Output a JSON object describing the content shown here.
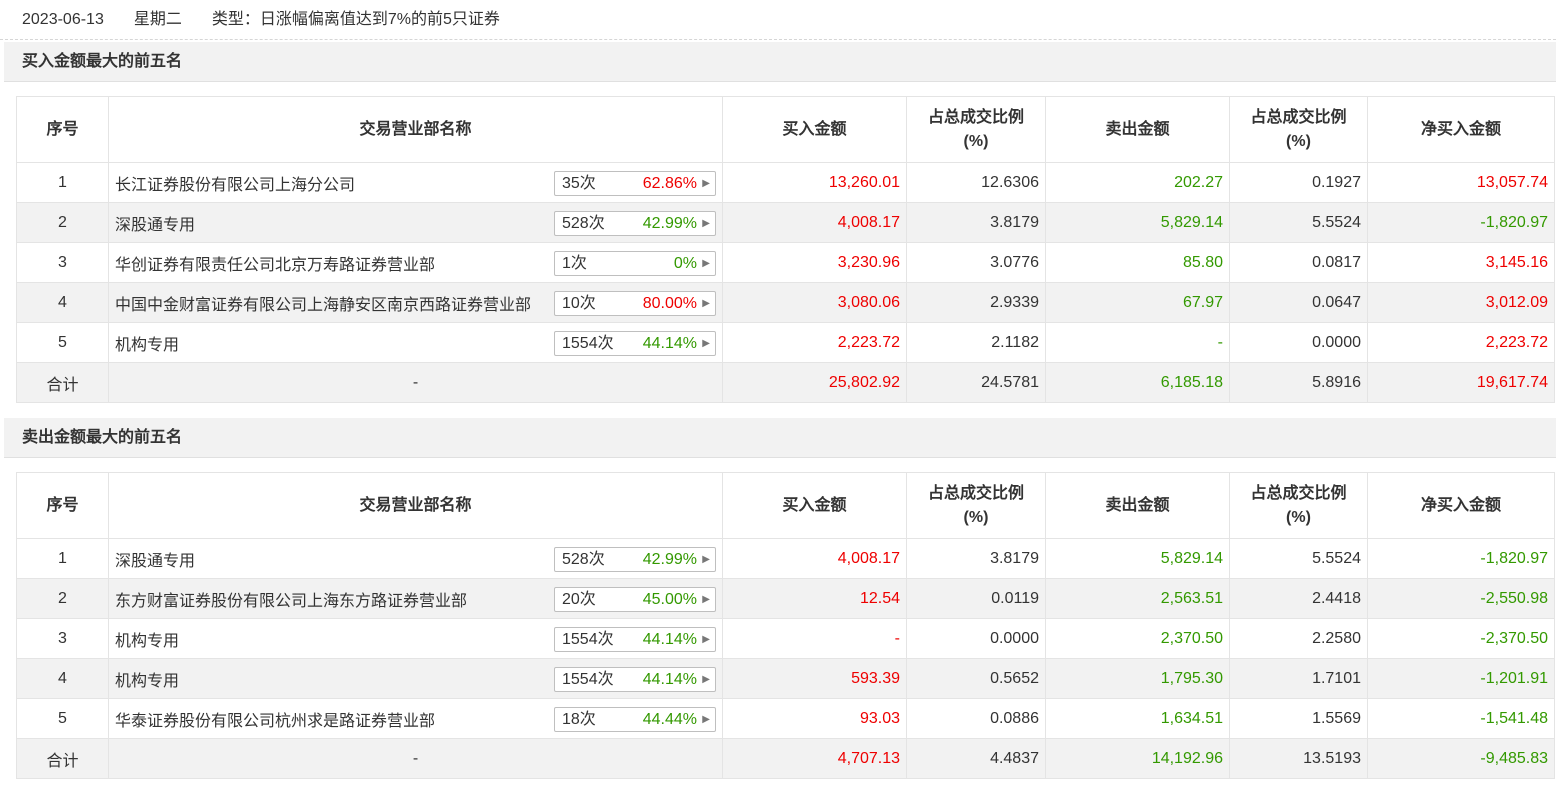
{
  "header": {
    "date": "2023-06-13",
    "weekday": "星期二",
    "type_text": "类型：日涨幅偏离值达到7%的前5只证券"
  },
  "columns": {
    "idx": "序号",
    "name": "交易营业部名称",
    "buy": "买入金额",
    "buy_pct": "占总成交比例\n(%)",
    "sell": "卖出金额",
    "sell_pct": "占总成交比例\n(%)",
    "net": "净买入金额"
  },
  "sections": [
    {
      "title": "买入金额最大的前五名",
      "rows": [
        {
          "idx": "1",
          "name": "长江证券股份有限公司上海分公司",
          "times": "35次",
          "rate": "62.86%",
          "rate_color": "red",
          "buy": "13,260.01",
          "buy_pct": "12.6306",
          "sell": "202.27",
          "sell_pct": "0.1927",
          "net": "13,057.74",
          "net_color": "red"
        },
        {
          "idx": "2",
          "name": "深股通专用",
          "times": "528次",
          "rate": "42.99%",
          "rate_color": "green",
          "buy": "4,008.17",
          "buy_pct": "3.8179",
          "sell": "5,829.14",
          "sell_pct": "5.5524",
          "net": "-1,820.97",
          "net_color": "green"
        },
        {
          "idx": "3",
          "name": "华创证券有限责任公司北京万寿路证券营业部",
          "times": "1次",
          "rate": "0%",
          "rate_color": "green",
          "buy": "3,230.96",
          "buy_pct": "3.0776",
          "sell": "85.80",
          "sell_pct": "0.0817",
          "net": "3,145.16",
          "net_color": "red"
        },
        {
          "idx": "4",
          "name": "中国中金财富证券有限公司上海静安区南京西路证券营业部",
          "times": "10次",
          "rate": "80.00%",
          "rate_color": "red",
          "buy": "3,080.06",
          "buy_pct": "2.9339",
          "sell": "67.97",
          "sell_pct": "0.0647",
          "net": "3,012.09",
          "net_color": "red"
        },
        {
          "idx": "5",
          "name": "机构专用",
          "times": "1554次",
          "rate": "44.14%",
          "rate_color": "green",
          "buy": "2,223.72",
          "buy_pct": "2.1182",
          "sell": "-",
          "sell_pct": "0.0000",
          "net": "2,223.72",
          "net_color": "red"
        }
      ],
      "total": {
        "label": "合计",
        "name": "-",
        "buy": "25,802.92",
        "buy_pct": "24.5781",
        "sell": "6,185.18",
        "sell_pct": "5.8916",
        "net": "19,617.74",
        "net_color": "red"
      }
    },
    {
      "title": "卖出金额最大的前五名",
      "rows": [
        {
          "idx": "1",
          "name": "深股通专用",
          "times": "528次",
          "rate": "42.99%",
          "rate_color": "green",
          "buy": "4,008.17",
          "buy_pct": "3.8179",
          "sell": "5,829.14",
          "sell_pct": "5.5524",
          "net": "-1,820.97",
          "net_color": "green"
        },
        {
          "idx": "2",
          "name": "东方财富证券股份有限公司上海东方路证券营业部",
          "times": "20次",
          "rate": "45.00%",
          "rate_color": "green",
          "buy": "12.54",
          "buy_pct": "0.0119",
          "sell": "2,563.51",
          "sell_pct": "2.4418",
          "net": "-2,550.98",
          "net_color": "green"
        },
        {
          "idx": "3",
          "name": "机构专用",
          "times": "1554次",
          "rate": "44.14%",
          "rate_color": "green",
          "buy": "-",
          "buy_pct": "0.0000",
          "sell": "2,370.50",
          "sell_pct": "2.2580",
          "net": "-2,370.50",
          "net_color": "green"
        },
        {
          "idx": "4",
          "name": "机构专用",
          "times": "1554次",
          "rate": "44.14%",
          "rate_color": "green",
          "buy": "593.39",
          "buy_pct": "0.5652",
          "sell": "1,795.30",
          "sell_pct": "1.7101",
          "net": "-1,201.91",
          "net_color": "green"
        },
        {
          "idx": "5",
          "name": "华泰证券股份有限公司杭州求是路证券营业部",
          "times": "18次",
          "rate": "44.44%",
          "rate_color": "green",
          "buy": "93.03",
          "buy_pct": "0.0886",
          "sell": "1,634.51",
          "sell_pct": "1.5569",
          "net": "-1,541.48",
          "net_color": "green"
        }
      ],
      "total": {
        "label": "合计",
        "name": "-",
        "buy": "4,707.13",
        "buy_pct": "4.4837",
        "sell": "14,192.96",
        "sell_pct": "13.5193",
        "net": "-9,485.83",
        "net_color": "green"
      }
    }
  ],
  "colors": {
    "red": "#ee0000",
    "green": "#339900",
    "stripe": "#f2f2f2"
  },
  "icons": {
    "row_arrow": "caret-right-icon"
  }
}
